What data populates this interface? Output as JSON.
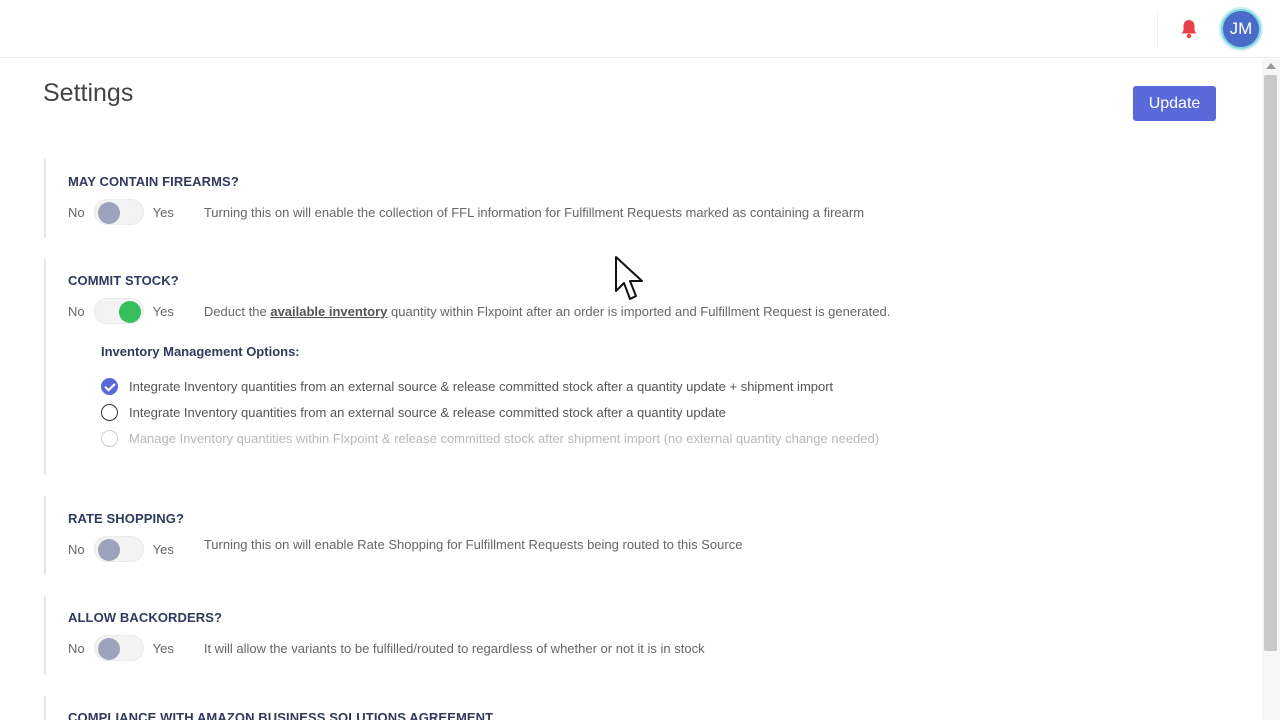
{
  "header": {
    "bell_icon": "bell-icon",
    "avatar_initials": "JM",
    "colors": {
      "bell": "#e8414a",
      "avatar_bg": "#4b6bc9",
      "avatar_ring": "#7fd6e0"
    }
  },
  "page": {
    "title": "Settings",
    "update_label": "Update",
    "accent": "#5a69d9"
  },
  "sections": {
    "firearms": {
      "title": "MAY CONTAIN FIREARMS?",
      "no": "No",
      "yes": "Yes",
      "enabled": false,
      "description": "Turning this on will enable the collection of FFL information for Fulfillment Requests marked as containing a firearm"
    },
    "commit_stock": {
      "title": "COMMIT STOCK?",
      "no": "No",
      "yes": "Yes",
      "enabled": true,
      "desc_before": "Deduct the",
      "desc_link": "available inventory",
      "desc_after": "quantity within Flxpoint after an order is imported and Fulfillment Request is generated.",
      "options_title": "Inventory Management Options:",
      "options": [
        {
          "label": "Integrate Inventory quantities from an external source & release committed stock after a quantity update + shipment import",
          "state": "checked"
        },
        {
          "label": "Integrate Inventory quantities from an external source & release committed stock after a quantity update",
          "state": "unchecked"
        },
        {
          "label": "Manage Inventory quantities within Flxpoint & release committed stock after shipment import (no external quantity change needed)",
          "state": "disabled"
        }
      ]
    },
    "rate_shopping": {
      "title": "RATE SHOPPING?",
      "no": "No",
      "yes": "Yes",
      "enabled": false,
      "description": "Turning this on will enable Rate Shopping for Fulfillment Requests being routed to this Source"
    },
    "backorders": {
      "title": "ALLOW BACKORDERS?",
      "no": "No",
      "yes": "Yes",
      "enabled": false,
      "description": "It will allow the variants to be fulfilled/routed to regardless of whether or not it is in stock"
    },
    "amazon": {
      "title": "COMPLIANCE WITH AMAZON BUSINESS SOLUTIONS AGREEMENT"
    }
  },
  "colors": {
    "toggle_on": "#33c05a",
    "toggle_off": "#9ea3bd",
    "heading": "#2f3a5c"
  }
}
